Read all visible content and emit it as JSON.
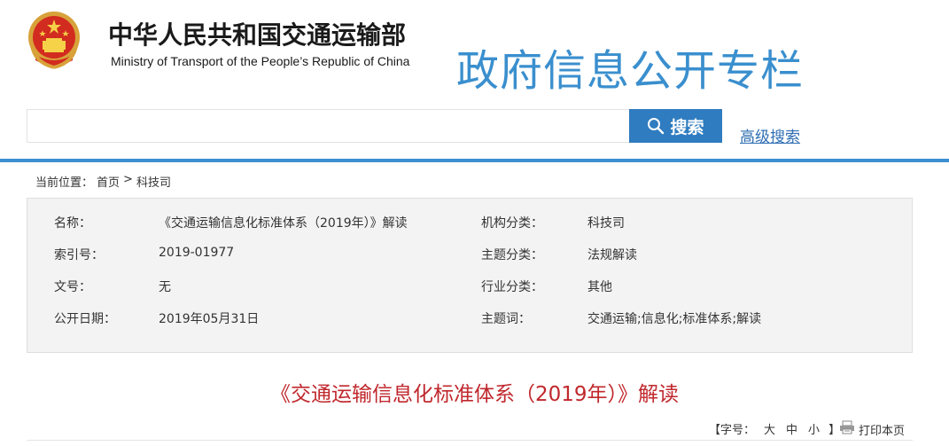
{
  "header": {
    "ministry_name_cn": "中华人民共和国交通运输部",
    "ministry_name_en": "Ministry of Transport of the People’s Republic of China",
    "column_title": "政府信息公开专栏"
  },
  "search": {
    "placeholder": "",
    "value": "",
    "button_label": "搜索",
    "advanced_label": "高级搜索"
  },
  "breadcrumb": {
    "prefix": "当前位置：",
    "home": "首页",
    "separator": ">",
    "current": "科技司"
  },
  "info": {
    "rows": [
      {
        "label1": "名称：",
        "value1": "《交通运输信息化标准体系（2019年）》解读",
        "label2": "机构分类：",
        "value2": "科技司"
      },
      {
        "label1": "索引号：",
        "value1": "2019-01977",
        "label2": "主题分类：",
        "value2": "法规解读"
      },
      {
        "label1": "文号：",
        "value1": "无",
        "label2": "行业分类：",
        "value2": "其他"
      },
      {
        "label1": "公开日期：",
        "value1": "2019年05月31日",
        "label2": "主题词：",
        "value2": "交通运输;信息化;标准体系;解读"
      }
    ]
  },
  "document": {
    "title": "《交通运输信息化标准体系（2019年）》解读"
  },
  "toolbar": {
    "font_size_label": "【字号：",
    "large": "大",
    "medium": "中",
    "small": "小",
    "close_bracket": "】",
    "print_label": "打印本页"
  },
  "colors": {
    "accent_blue": "#2f7cc0",
    "title_red": "#c0282d",
    "column_title_blue": "#3a8fce"
  }
}
